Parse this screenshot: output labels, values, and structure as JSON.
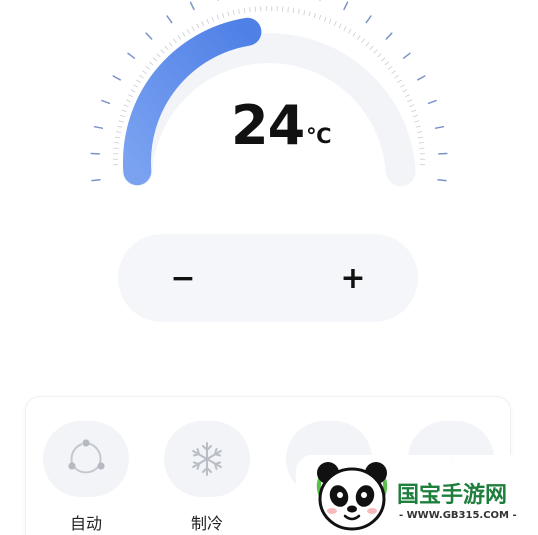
{
  "thermostat": {
    "temperature": "24",
    "unit": "℃",
    "level": 0.45,
    "accent_color": "#5b8ae8"
  },
  "stepper": {
    "decrease_label": "−",
    "increase_label": "+"
  },
  "modes": [
    {
      "label": "自动",
      "icon": "auto-cycle-icon",
      "selected": false
    },
    {
      "label": "制冷",
      "icon": "snowflake-icon",
      "selected": false
    },
    {
      "label": "",
      "icon": "mode-icon",
      "selected": false
    },
    {
      "label": "",
      "icon": "mode-icon",
      "selected": false
    }
  ],
  "watermark": {
    "name": "国宝手游网",
    "url": "- WWW.GB315.COM -",
    "brand_color": "#1e7f3d"
  }
}
